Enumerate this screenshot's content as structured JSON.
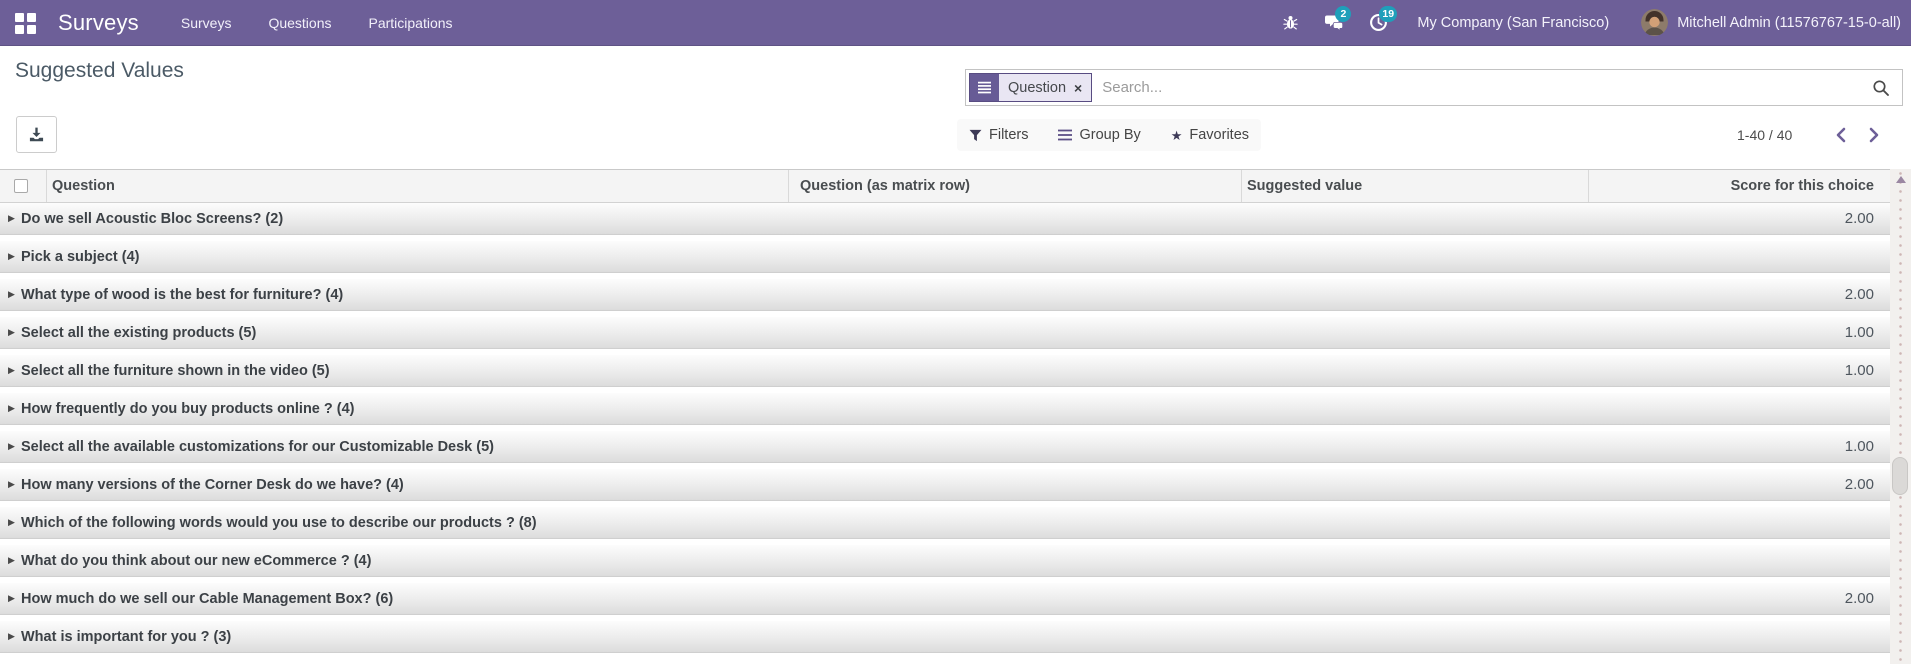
{
  "navbar": {
    "brand": "Surveys",
    "menu_items": [
      "Surveys",
      "Questions",
      "Participations"
    ],
    "message_badge": "2",
    "activity_badge": "19",
    "company": "My Company (San Francisco)",
    "user": "Mitchell Admin (11576767-15-0-all)"
  },
  "control_panel": {
    "title": "Suggested Values",
    "search": {
      "facet_label": "Question",
      "facet_remove": "×",
      "placeholder": "Search..."
    },
    "filters_label": "Filters",
    "group_by_label": "Group By",
    "favorites_label": "Favorites",
    "pager_range": "1-40 / 40"
  },
  "table": {
    "columns": [
      "Question",
      "Question (as matrix row)",
      "Suggested value",
      "Score for this choice"
    ],
    "groups": [
      {
        "label": "Do we sell Acoustic Bloc Screens? (2)",
        "score": "2.00"
      },
      {
        "label": "Pick a subject (4)",
        "score": ""
      },
      {
        "label": "What type of wood is the best for furniture? (4)",
        "score": "2.00"
      },
      {
        "label": "Select all the existing products (5)",
        "score": "1.00"
      },
      {
        "label": "Select all the furniture shown in the video (5)",
        "score": "1.00"
      },
      {
        "label": "How frequently do you buy products online ? (4)",
        "score": ""
      },
      {
        "label": "Select all the available customizations for our Customizable Desk (5)",
        "score": "1.00"
      },
      {
        "label": "How many versions of the Corner Desk do we have? (4)",
        "score": "2.00"
      },
      {
        "label": "Which of the following words would you use to describe our products ? (8)",
        "score": ""
      },
      {
        "label": "What do you think about our new eCommerce ? (4)",
        "score": ""
      },
      {
        "label": "How much do we sell our Cable Management Box? (6)",
        "score": "2.00"
      },
      {
        "label": "What is important for you ? (3)",
        "score": ""
      }
    ]
  },
  "icons": {
    "apps": "grid-2x2",
    "bug": "debug-bug",
    "messages": "chat-bubbles",
    "activity": "clock",
    "search": "magnifier",
    "export": "download-tray",
    "filters": "funnel",
    "group_by": "bars",
    "favorites": "star",
    "facet": "group-bars",
    "row_caret": "right-triangle"
  },
  "colors": {
    "navbar_bg": "#6d5f98",
    "badge_bg": "#1f9fba",
    "facet_purple": "#675b96",
    "pager_accent": "#6d5f98",
    "row_gradient_bottom": "#dcdcdc",
    "header_bg": "#f4f4f4"
  }
}
